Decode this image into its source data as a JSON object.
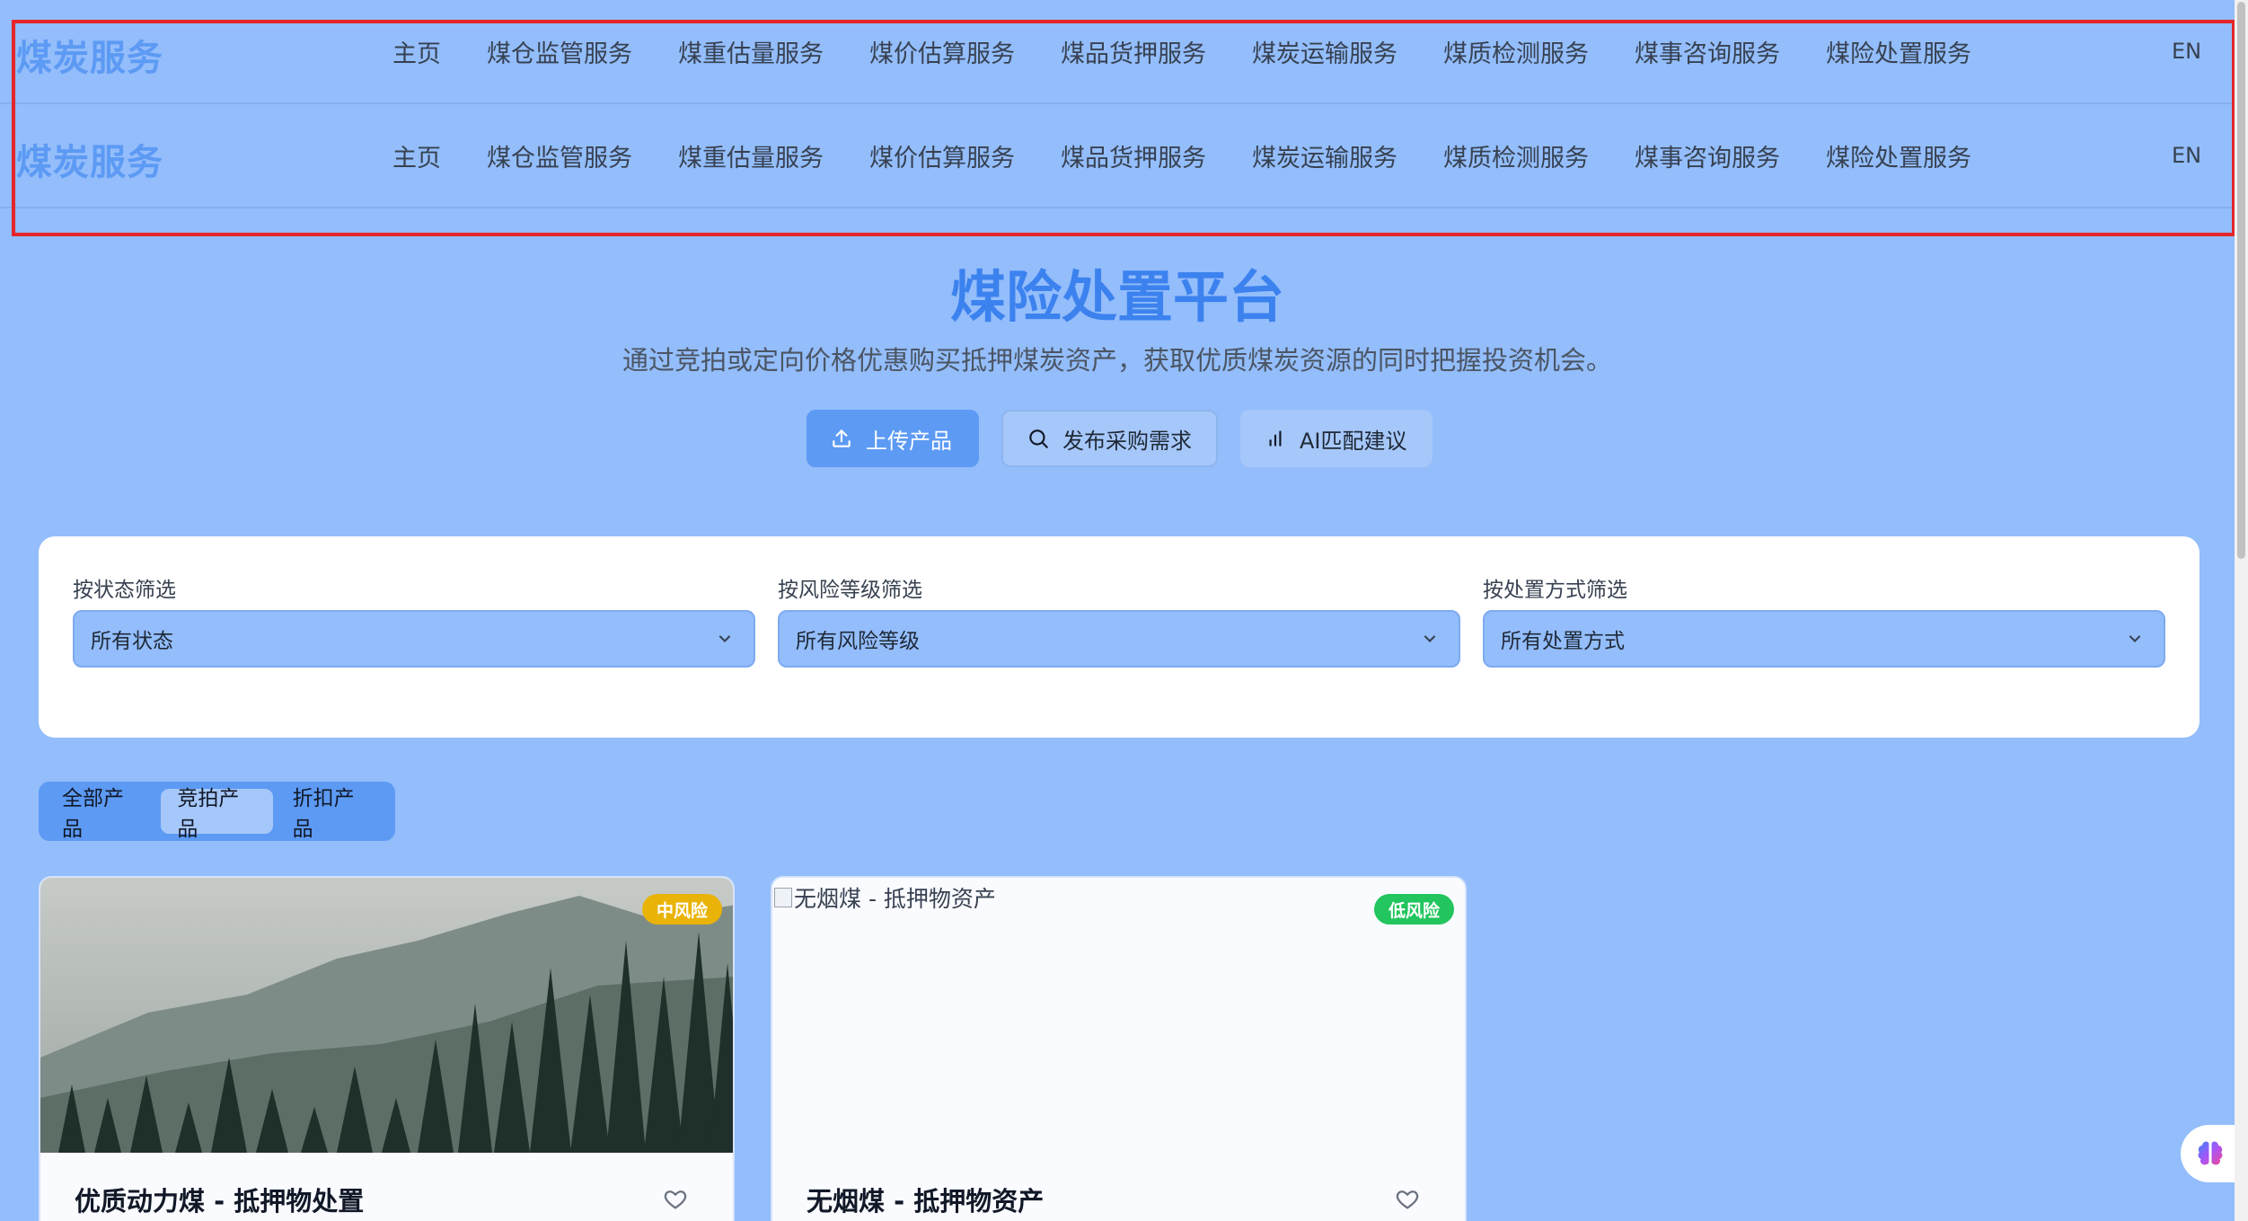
{
  "nav": {
    "logo": "煤炭服务",
    "items": [
      "主页",
      "煤仓监管服务",
      "煤重估量服务",
      "煤价估算服务",
      "煤品货押服务",
      "煤炭运输服务",
      "煤质检测服务",
      "煤事咨询服务",
      "煤险处置服务"
    ],
    "lang": "EN"
  },
  "hero": {
    "title": "煤险处置平台",
    "subtitle": "通过竞拍或定向价格优惠购买抵押煤炭资产，获取优质煤炭资源的同时把握投资机会。",
    "buttons": {
      "upload": "上传产品",
      "publish": "发布采购需求",
      "ai": "AI匹配建议"
    }
  },
  "filters": {
    "status": {
      "label": "按状态筛选",
      "value": "所有状态"
    },
    "risk": {
      "label": "按风险等级筛选",
      "value": "所有风险等级"
    },
    "method": {
      "label": "按处置方式筛选",
      "value": "所有处置方式"
    }
  },
  "tabs": [
    "全部产品",
    "竞拍产品",
    "折扣产品"
  ],
  "active_tab": "竞拍产品",
  "products": [
    {
      "title": "优质动力煤 - 抵押物处置",
      "badge": "中风险",
      "image_alt": ""
    },
    {
      "title": "无烟煤 - 抵押物资产",
      "badge": "低风险",
      "image_alt": "无烟煤 - 抵押物资产"
    }
  ],
  "colors": {
    "background": "#93bdfb",
    "accent": "#5c9af4",
    "title": "#3c82ef",
    "badge_mid": "#eab308",
    "badge_low": "#22c55e"
  }
}
